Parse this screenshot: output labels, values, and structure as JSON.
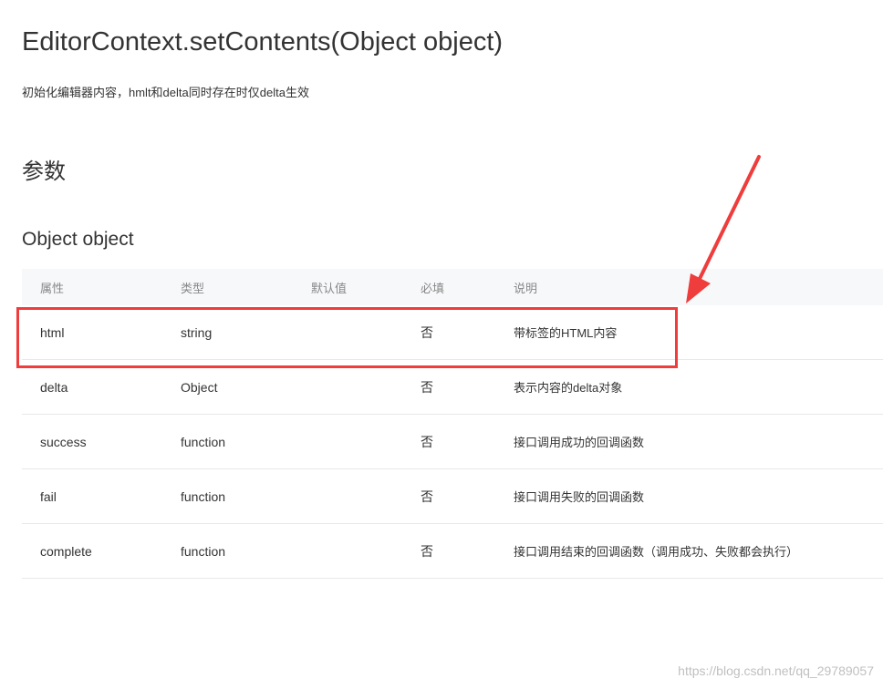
{
  "page": {
    "title": "EditorContext.setContents(Object object)",
    "description": "初始化编辑器内容，hmlt和delta同时存在时仅delta生效",
    "section_heading": "参数",
    "sub_heading": "Object object"
  },
  "table": {
    "headers": [
      "属性",
      "类型",
      "默认值",
      "必填",
      "说明"
    ],
    "rows": [
      {
        "name": "html",
        "type": "string",
        "default": "",
        "required": "否",
        "desc": "带标签的HTML内容"
      },
      {
        "name": "delta",
        "type": "Object",
        "default": "",
        "required": "否",
        "desc": "表示内容的delta对象"
      },
      {
        "name": "success",
        "type": "function",
        "default": "",
        "required": "否",
        "desc": "接口调用成功的回调函数"
      },
      {
        "name": "fail",
        "type": "function",
        "default": "",
        "required": "否",
        "desc": "接口调用失败的回调函数"
      },
      {
        "name": "complete",
        "type": "function",
        "default": "",
        "required": "否",
        "desc": "接口调用结束的回调函数（调用成功、失败都会执行）"
      }
    ]
  },
  "annotation": {
    "color": "#ef3c3c",
    "highlighted_row": "html"
  },
  "watermark": "https://blog.csdn.net/qq_29789057"
}
